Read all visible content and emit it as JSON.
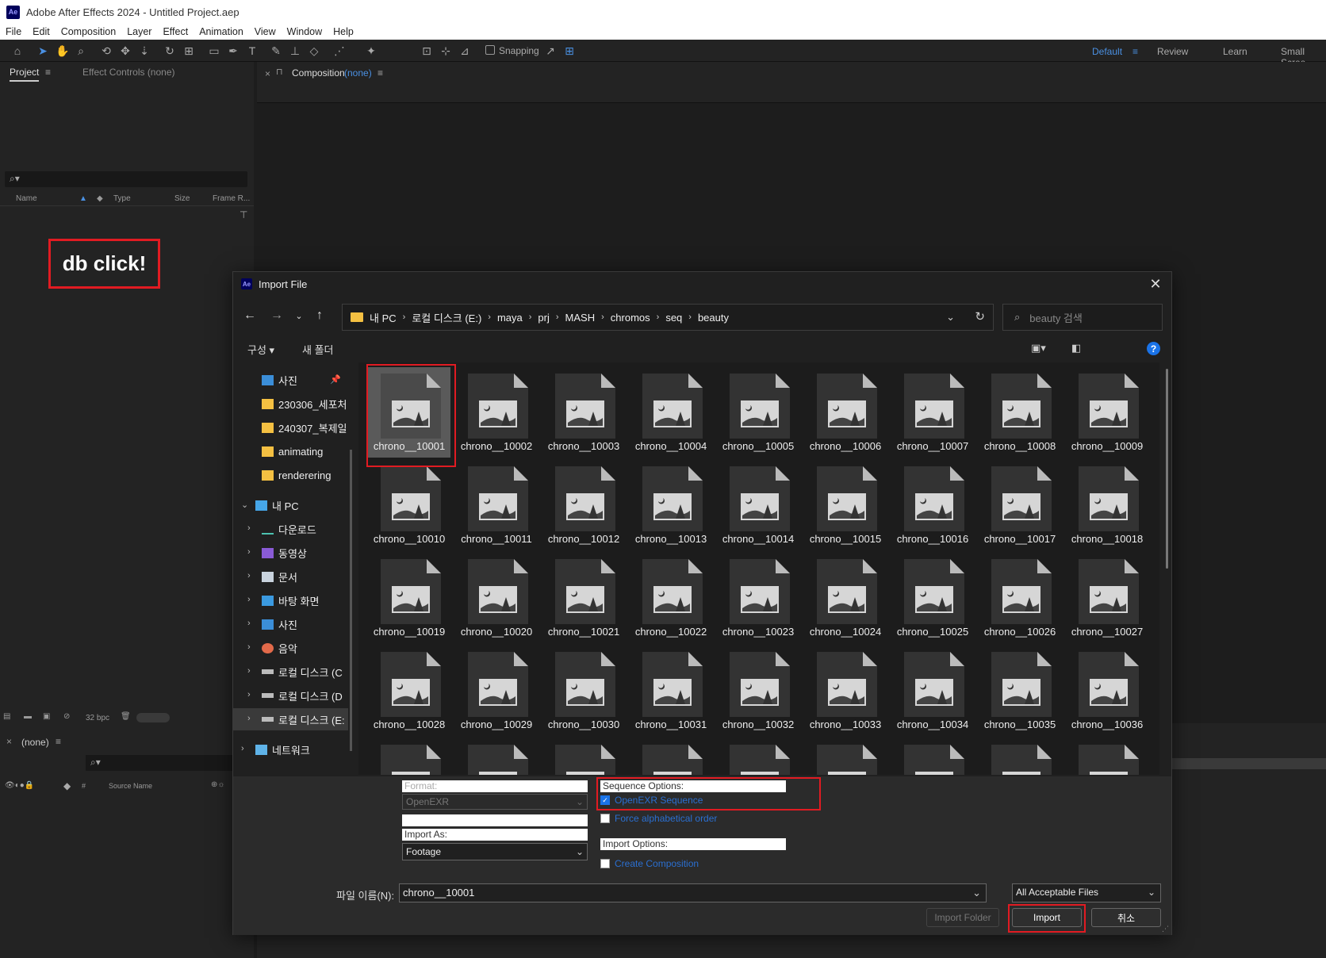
{
  "app": {
    "title": "Adobe After Effects 2024 - Untitled Project.aep",
    "logo": "Ae",
    "menu": [
      "File",
      "Edit",
      "Composition",
      "Layer",
      "Effect",
      "Animation",
      "View",
      "Window",
      "Help"
    ],
    "snapping_label": "Snapping",
    "workspaces": [
      "Default",
      "Review",
      "Learn",
      "Small Scree"
    ]
  },
  "project_panel": {
    "tab_project": "Project",
    "tab_effect_controls": "Effect Controls (none)",
    "columns": [
      "Name",
      "Type",
      "Size",
      "Frame R..."
    ],
    "bpc": "32 bpc"
  },
  "composition_panel": {
    "tab_label": "Composition",
    "tab_value": "(none)"
  },
  "timeline": {
    "tab": "(none)",
    "source_name_col": "Source Name"
  },
  "annotation": {
    "text": "db click!"
  },
  "dialog": {
    "logo": "Ae",
    "title": "Import File",
    "path": [
      "내 PC",
      "로컬 디스크 (E:)",
      "maya",
      "prj",
      "MASH",
      "chromos",
      "seq",
      "beauty"
    ],
    "search_placeholder": "beauty 검색",
    "cmd_organize": "구성 ▾",
    "cmd_new_folder": "새 폴더",
    "nav_items": [
      {
        "label": "사진",
        "type": "photos"
      },
      {
        "label": "230306_세포처",
        "type": "folder"
      },
      {
        "label": "240307_복제일",
        "type": "folder"
      },
      {
        "label": "animating",
        "type": "folder"
      },
      {
        "label": "renderering",
        "type": "folder"
      },
      {
        "label": "내 PC",
        "type": "pc"
      },
      {
        "label": "다운로드",
        "type": "download"
      },
      {
        "label": "동영상",
        "type": "video"
      },
      {
        "label": "문서",
        "type": "docs"
      },
      {
        "label": "바탕 화면",
        "type": "desktop"
      },
      {
        "label": "사진",
        "type": "photos"
      },
      {
        "label": "음악",
        "type": "music"
      },
      {
        "label": "로컬 디스크 (C",
        "type": "drive"
      },
      {
        "label": "로컬 디스크 (D",
        "type": "drive"
      },
      {
        "label": "로컬 디스크 (E:",
        "type": "drive"
      },
      {
        "label": "네트워크",
        "type": "network"
      }
    ],
    "files": [
      "chrono__10001",
      "chrono__10002",
      "chrono__10003",
      "chrono__10004",
      "chrono__10005",
      "chrono__10006",
      "chrono__10007",
      "chrono__10008",
      "chrono__10009",
      "chrono__10010",
      "chrono__10011",
      "chrono__10012",
      "chrono__10013",
      "chrono__10014",
      "chrono__10015",
      "chrono__10016",
      "chrono__10017",
      "chrono__10018",
      "chrono__10019",
      "chrono__10020",
      "chrono__10021",
      "chrono__10022",
      "chrono__10023",
      "chrono__10024",
      "chrono__10025",
      "chrono__10026",
      "chrono__10027",
      "chrono__10028",
      "chrono__10029",
      "chrono__10030",
      "chrono__10031",
      "chrono__10032",
      "chrono__10033",
      "chrono__10034",
      "chrono__10035",
      "chrono__10036"
    ],
    "selected_file": "chrono__10001",
    "format_label": "Format:",
    "format_value": "OpenEXR",
    "import_as_label": "Import As:",
    "import_as_value": "Footage",
    "sequence_options_label": "Sequence Options:",
    "openexr_sequence": "OpenEXR Sequence",
    "force_alpha": "Force alphabetical order",
    "import_options_label": "Import Options:",
    "create_composition": "Create Composition",
    "filename_label": "파일 이름(N):",
    "filename_value": "chrono__10001",
    "filter_value": "All Acceptable Files",
    "btn_import_folder": "Import Folder",
    "btn_import": "Import",
    "btn_cancel": "취소"
  },
  "colors": {
    "accent": "#1a73e8",
    "annotation_red": "#e11b22",
    "folder": "#f4c042"
  }
}
